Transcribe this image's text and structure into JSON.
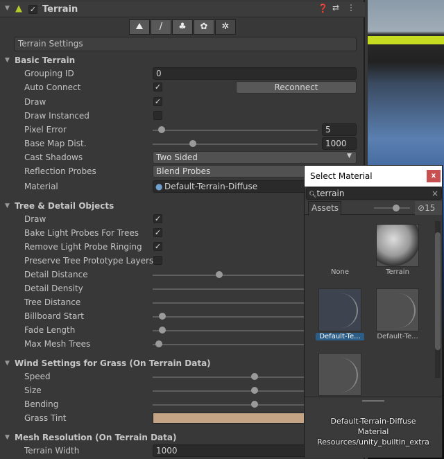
{
  "component": {
    "title": "Terrain",
    "enabled": true
  },
  "toolbar": [
    {
      "icon": "raise-terrain-icon",
      "g": "⛰"
    },
    {
      "icon": "paint-brush-icon",
      "g": "/"
    },
    {
      "icon": "paint-trees-icon",
      "g": "♣"
    },
    {
      "icon": "paint-details-icon",
      "g": "✿"
    },
    {
      "icon": "settings-gear-icon",
      "g": "✲"
    }
  ],
  "settings_label": "Terrain Settings",
  "sections": {
    "basic": "Basic Terrain",
    "tree": "Tree & Detail Objects",
    "wind": "Wind Settings for Grass (On Terrain Data)",
    "mesh": "Mesh Resolution (On Terrain Data)"
  },
  "rows": [
    {
      "label": "Grouping ID",
      "type": "field",
      "value": "0"
    },
    {
      "label": "Auto Connect",
      "type": "check",
      "checked": true,
      "button": "Reconnect"
    },
    {
      "label": "Draw",
      "type": "check",
      "checked": true
    },
    {
      "label": "Draw Instanced",
      "type": "check",
      "checked": false
    },
    {
      "label": "Pixel Error",
      "type": "slider",
      "level": 0.03,
      "value": "5"
    },
    {
      "label": "Base Map Dist.",
      "type": "slider",
      "level": 0.23,
      "value": "1000"
    },
    {
      "label": "Cast Shadows",
      "type": "drop",
      "value": "Two Sided"
    },
    {
      "label": "Reflection Probes",
      "type": "drop",
      "value": "Blend Probes"
    },
    {
      "label": "Material",
      "type": "object",
      "value": "Default-Terrain-Diffuse"
    },
    {
      "label": "Draw",
      "type": "check",
      "checked": true
    },
    {
      "label": "Bake Light Probes For Trees",
      "type": "check",
      "checked": true
    },
    {
      "label": "Remove Light Probe Ringing",
      "type": "check",
      "checked": true
    },
    {
      "label": "Preserve Tree Prototype Layers",
      "type": "check",
      "checked": false
    },
    {
      "label": "Detail Distance",
      "type": "slider",
      "level": 0.32
    },
    {
      "label": "Detail Density",
      "type": "slider",
      "level": 1
    },
    {
      "label": "Tree Distance",
      "type": "slider",
      "level": 1
    },
    {
      "label": "Billboard Start",
      "type": "slider",
      "level": 0.03
    },
    {
      "label": "Fade Length",
      "type": "slider",
      "level": 0.03
    },
    {
      "label": "Max Mesh Trees",
      "type": "slider",
      "level": 0.01
    },
    {
      "label": "Speed",
      "type": "slider",
      "level": 0.5
    },
    {
      "label": "Size",
      "type": "slider",
      "level": 0.5
    },
    {
      "label": "Bending",
      "type": "slider",
      "level": 0.5
    },
    {
      "label": "Grass Tint",
      "type": "color",
      "color": "#c4a484"
    },
    {
      "label": "Terrain Width",
      "type": "field",
      "value": "1000"
    }
  ],
  "popup": {
    "title": "Select Material",
    "close": "x",
    "search": "terrain",
    "tab": "Assets",
    "hidden_count": "15",
    "items": [
      {
        "name": "None"
      },
      {
        "name": "Terrain"
      },
      {
        "name": "Default-Te...",
        "selected": true
      },
      {
        "name": "Default-Te..."
      },
      {
        "name": ""
      }
    ],
    "info": [
      "Default-Terrain-Diffuse",
      "Material",
      "Resources/unity_builtin_extra"
    ]
  },
  "colors": {
    "accent": "#2c5d87",
    "close": "#c75050"
  }
}
